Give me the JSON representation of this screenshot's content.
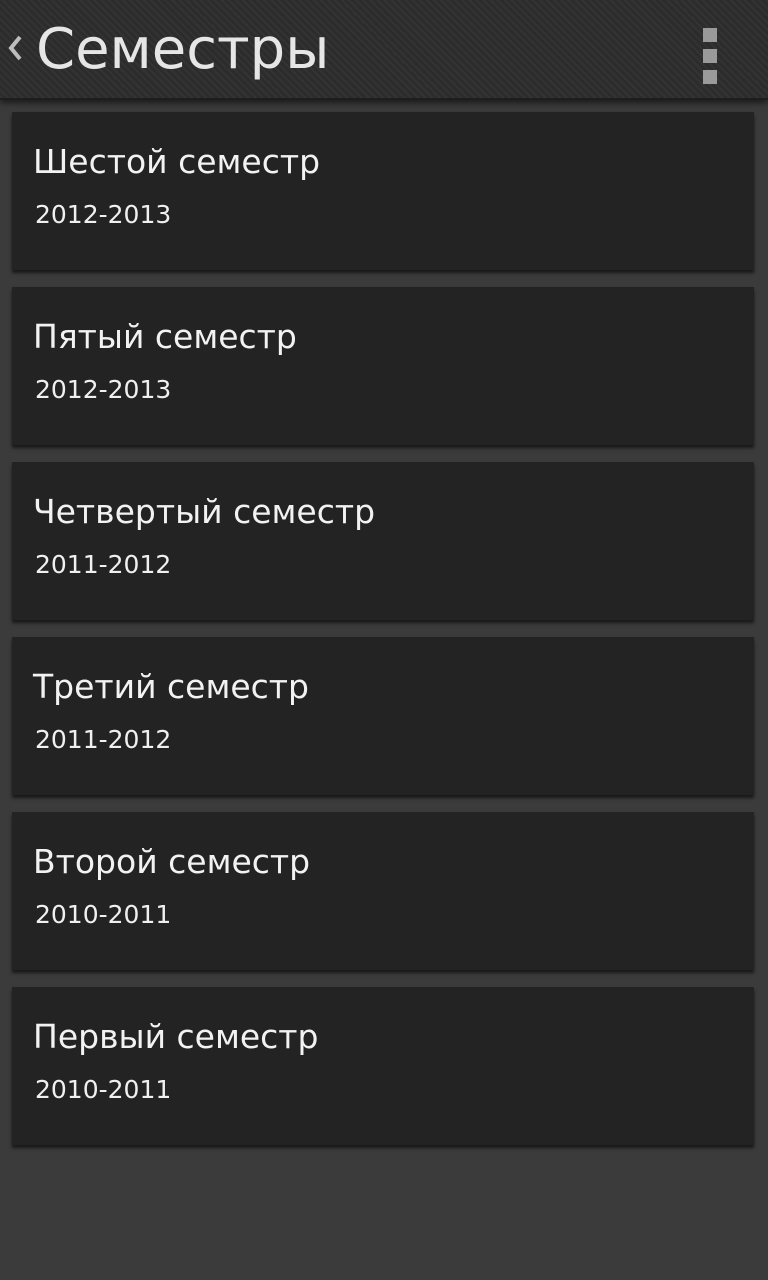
{
  "action_bar": {
    "title": "Семестры",
    "up_icon": "chevron-left-icon",
    "overflow_icon": "overflow-menu-icon"
  },
  "semesters": [
    {
      "title": "Шестой семестр",
      "years": "2012-2013"
    },
    {
      "title": "Пятый семестр",
      "years": "2012-2013"
    },
    {
      "title": "Четвертый семестр",
      "years": "2011-2012"
    },
    {
      "title": "Третий семестр",
      "years": "2011-2012"
    },
    {
      "title": "Второй семестр",
      "years": "2010-2011"
    },
    {
      "title": "Первый семестр",
      "years": "2010-2011"
    }
  ],
  "colors": {
    "background": "#3b3b3b",
    "card": "#232323",
    "action_bar": "#2c2c2c",
    "text": "#f2f2f2"
  }
}
